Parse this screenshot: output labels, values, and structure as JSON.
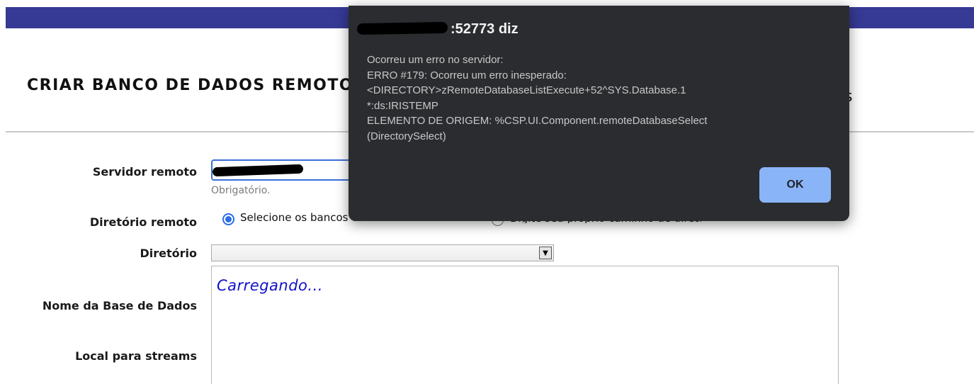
{
  "page": {
    "title": "CRIAR BANCO DE DADOS REMOTO",
    "title_tail": "s"
  },
  "form": {
    "server_label": "Servidor remoto",
    "server_required": "Obrigatório.",
    "remote_dir_label": "Diretório remoto",
    "radio_select_label": "Selecione os bancos de dados no servidor",
    "radio_other_label": "Digite seu próprio caminho de diretório",
    "directory_label": "Diretório",
    "db_name_label": "Nome da Base de Dados",
    "streams_label": "Local para streams",
    "loading_text": "Carregando..."
  },
  "dialog": {
    "title_suffix": ":52773 diz",
    "message_lines": [
      "Ocorreu um erro no servidor:",
      "ERRO #179: Ocorreu um erro inesperado:",
      "<DIRECTORY>zRemoteDatabaseListExecute+52^SYS.Database.1",
      "*:ds:IRISTEMP",
      "ELEMENTO DE ORIGEM: %CSP.UI.Component.remoteDatabaseSelect",
      "(DirectorySelect)"
    ],
    "ok_label": "OK"
  },
  "colors": {
    "topbar": "#363a95",
    "dialog_bg": "#2b2c2f",
    "ok_button": "#8ab4f8",
    "loading_text": "#1010c8"
  }
}
